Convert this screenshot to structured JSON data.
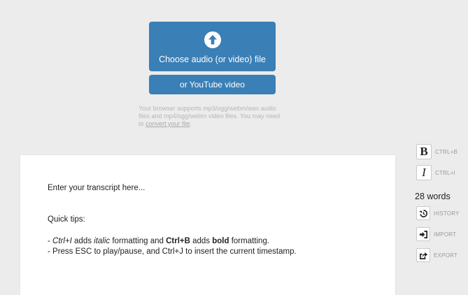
{
  "upload": {
    "choose_file_label": "Choose audio (or video) file",
    "youtube_label": "or YouTube video",
    "support_text": "Your browser supports mp3/ogg/webm/wav audio files and mp4/ogg/webm video files. You may need to ",
    "convert_link": "convert your file",
    "support_end": "."
  },
  "editor": {
    "placeholder_line": "Enter your transcript here...",
    "tips_heading": "Quick tips:",
    "tip1_prefix": "- ",
    "tip1_key1": "Ctrl+I",
    "tip1_mid1": " adds ",
    "tip1_italic": "italic",
    "tip1_mid2": " formatting and ",
    "tip1_key2": "Ctrl+B",
    "tip1_mid3": " adds ",
    "tip1_bold": "bold",
    "tip1_end": " formatting.",
    "tip2": "- Press ESC to play/pause, and Ctrl+J to insert the current timestamp."
  },
  "toolbar": {
    "bold_glyph": "B",
    "bold_shortcut": "CTRL+B",
    "italic_glyph": "I",
    "italic_shortcut": "CTRL+I",
    "word_count": "28 words",
    "history_label": "HISTORY",
    "import_label": "IMPORT",
    "export_label": "EXPORT"
  },
  "colors": {
    "accent": "#3a7fb6",
    "background": "#ececec"
  }
}
